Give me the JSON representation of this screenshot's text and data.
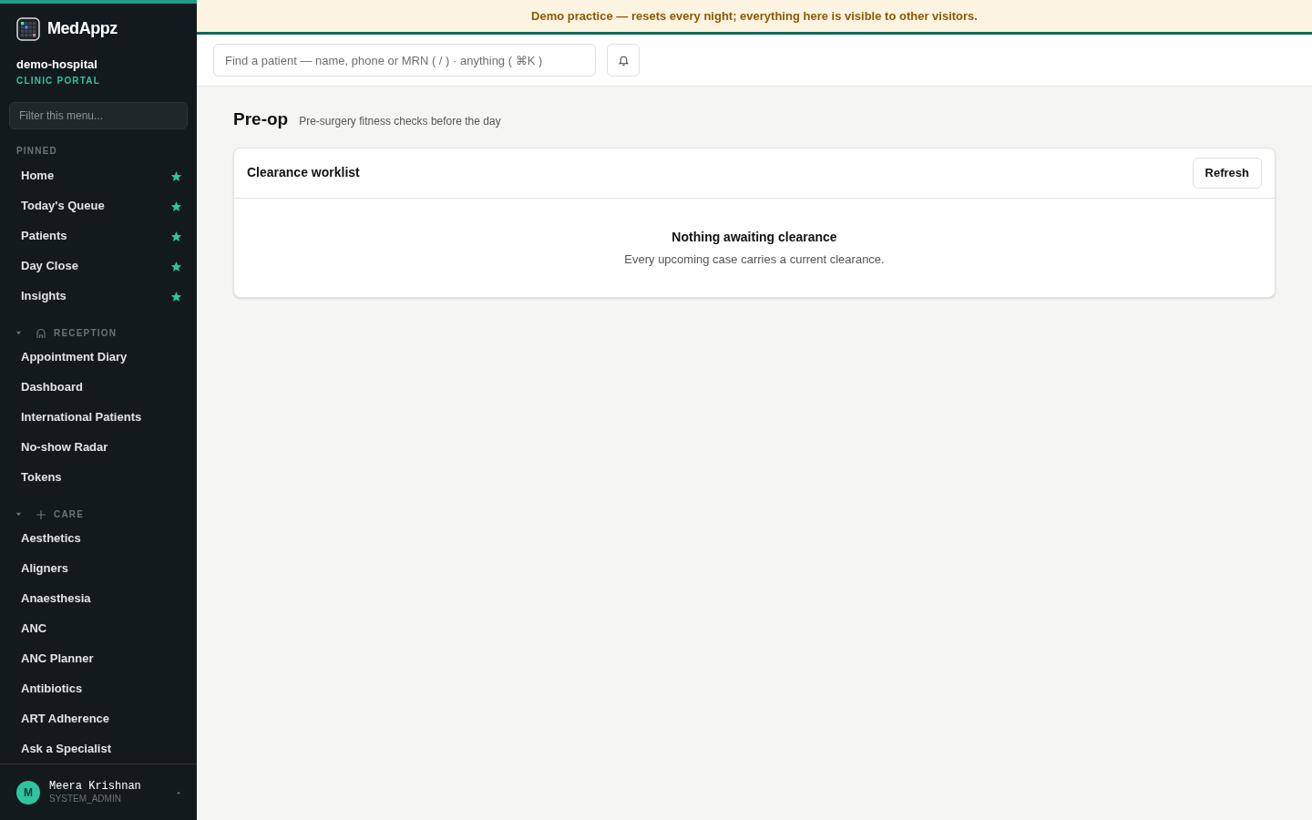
{
  "brand": {
    "name": "MedAppz",
    "org": "demo-hospital",
    "portal": "CLINIC PORTAL"
  },
  "sidebar": {
    "filter": {
      "placeholder": "Filter this menu..."
    },
    "pinned": {
      "label": "PINNED",
      "items": [
        {
          "label": "Home",
          "starred": true
        },
        {
          "label": "Today's Queue",
          "starred": true
        },
        {
          "label": "Patients",
          "starred": true
        },
        {
          "label": "Day Close",
          "starred": true
        },
        {
          "label": "Insights",
          "starred": true
        }
      ]
    },
    "groups": [
      {
        "label": "RECEPTION",
        "kind": "reception",
        "expanded": true,
        "items": [
          {
            "label": "Appointment Diary"
          },
          {
            "label": "Dashboard"
          },
          {
            "label": "International Patients"
          },
          {
            "label": "No-show Radar"
          },
          {
            "label": "Tokens"
          }
        ]
      },
      {
        "label": "CARE",
        "kind": "care",
        "expanded": true,
        "items": [
          {
            "label": "Aesthetics"
          },
          {
            "label": "Aligners"
          },
          {
            "label": "Anaesthesia"
          },
          {
            "label": "ANC"
          },
          {
            "label": "ANC Planner"
          },
          {
            "label": "Antibiotics"
          },
          {
            "label": "ART Adherence"
          },
          {
            "label": "Ask a Specialist"
          }
        ]
      }
    ],
    "user": {
      "initial": "M",
      "name": "Meera Krishnan",
      "role": "SYSTEM_ADMIN"
    }
  },
  "banner": "Demo practice — resets every night; everything here is visible to other visitors.",
  "search": {
    "placeholder": "Find a patient — name, phone or MRN ( / ) · anything ( ⌘K )"
  },
  "page": {
    "title": "Pre-op",
    "subtitle": "Pre-surgery fitness checks before the day"
  },
  "card": {
    "title": "Clearance worklist",
    "button": "Refresh",
    "empty_title": "Nothing awaiting clearance",
    "empty_text": "Every upcoming case carries a current clearance."
  }
}
